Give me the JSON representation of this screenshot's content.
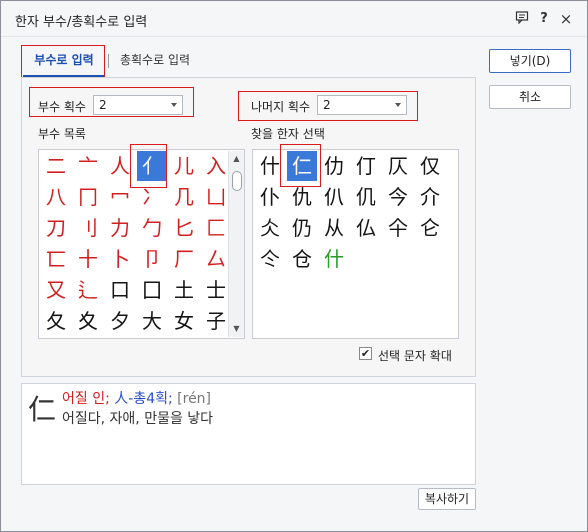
{
  "window": {
    "title": "한자 부수/총획수로 입력",
    "icons": [
      "chat-icon",
      "help-icon",
      "close-icon"
    ]
  },
  "tabs": [
    {
      "label": "부수로 입력",
      "active": true
    },
    {
      "label": "총획수로 입력",
      "active": false
    }
  ],
  "radical_count": {
    "label": "부수 획수",
    "value": "2"
  },
  "remaining_count": {
    "label": "나머지 획수",
    "value": "2"
  },
  "radical_list": {
    "label": "부수 목록",
    "rows": [
      [
        "二",
        "亠",
        "人",
        "亻",
        "儿",
        "入"
      ],
      [
        "八",
        "冂",
        "冖",
        "冫",
        "几",
        "凵"
      ],
      [
        "刀",
        "刂",
        "力",
        "勹",
        "匕",
        "匚"
      ],
      [
        "匸",
        "十",
        "卜",
        "卩",
        "厂",
        "厶"
      ],
      [
        "又",
        "⻍",
        "口",
        "囗",
        "土",
        "士"
      ],
      [
        "夂",
        "夊",
        "夕",
        "大",
        "女",
        "子"
      ]
    ],
    "selected": "亻"
  },
  "hanja_list": {
    "label": "찾을 한자 선택",
    "rows": [
      [
        "什",
        "仁",
        "仂",
        "仃",
        "仄",
        "仅"
      ],
      [
        "仆",
        "仇",
        "仈",
        "仉",
        "今",
        "介"
      ],
      [
        "仌",
        "仍",
        "从",
        "仏",
        "仐",
        "仑"
      ],
      [
        "仒",
        "仓",
        "什"
      ]
    ],
    "selected": "仁"
  },
  "enlarge_checkbox": {
    "label": "선택 문자 확대",
    "checked": true
  },
  "info": {
    "glyph": "仁",
    "meaning": "어질 인;",
    "radical_info": "人-총4획;",
    "reading": "[rén]",
    "description": "어질다, 자애, 만물을 낳다"
  },
  "buttons": {
    "insert": "넣기(D)",
    "cancel": "취소",
    "copy": "복사하기"
  },
  "colors": {
    "selection": "#3b79d8",
    "highlight_box": "#d81b1b",
    "radical_red": "#d21f1f",
    "accent": "#1c4fb0",
    "green_char": "#2a9a2a"
  }
}
